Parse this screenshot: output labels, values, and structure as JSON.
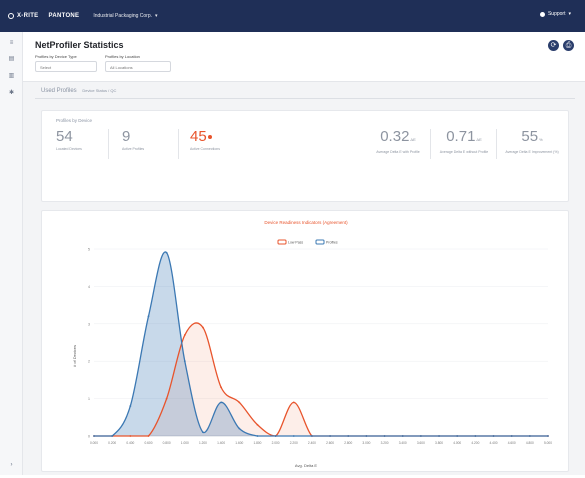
{
  "topbar": {
    "brand": "X-RITE",
    "brand_sub": "PANTONE",
    "workspace": "Industrial Packaging Corp.",
    "user": "Support"
  },
  "header": {
    "title": "NetProfiler Statistics",
    "filter1_label": "Profiles by Device Type",
    "filter1_value": "Select",
    "filter2_label": "Profiles by Location",
    "filter2_value": "All Locations"
  },
  "breadcrumb": {
    "title": "Used Profiles",
    "subtitle": "Device Status / QC"
  },
  "stats": {
    "section_title": "Profiles by Device",
    "items": [
      {
        "value": "54",
        "unit": "",
        "label": "Located Devices"
      },
      {
        "value": "9",
        "unit": "",
        "label": "Active Profiles"
      },
      {
        "value": "45",
        "unit": "",
        "label": "Active Connections"
      },
      {
        "value": "0.32",
        "unit": "ΔE",
        "label": "Average Delta E with Profile"
      },
      {
        "value": "0.71",
        "unit": "ΔE",
        "label": "Average Delta E without Profile"
      },
      {
        "value": "55",
        "unit": "%",
        "label": "Average Delta E Improvement (%)"
      }
    ]
  },
  "chart_data": {
    "type": "area",
    "title": "Device Readiness Indicators (Agreement)",
    "xlabel": "Avg. Delta E",
    "ylabel": "# of Devices",
    "ylim": [
      0,
      5
    ],
    "yticks": [
      0,
      1,
      2,
      3,
      4,
      5
    ],
    "xticks": [
      "0.000",
      "0.200",
      "0.400",
      "0.600",
      "0.800",
      "1.000",
      "1.200",
      "1.400",
      "1.600",
      "1.800",
      "2.000",
      "2.200",
      "2.400",
      "2.600",
      "2.800",
      "3.000",
      "3.200",
      "3.400",
      "3.600",
      "3.800",
      "4.000",
      "4.200",
      "4.400",
      "4.600",
      "4.800",
      "5.000"
    ],
    "legend": "top-center",
    "series": [
      {
        "name": "Low Pass",
        "color": "#e8542c",
        "values": [
          0,
          0,
          0,
          0,
          1.0,
          2.7,
          2.9,
          1.3,
          0.9,
          0.3,
          0,
          0.9,
          0,
          0,
          0,
          0,
          0,
          0,
          0,
          0,
          0,
          0,
          0,
          0,
          0,
          0
        ]
      },
      {
        "name": "Profiles",
        "color": "#3b78b3",
        "values": [
          0,
          0,
          0.8,
          3.2,
          4.9,
          2.0,
          0.1,
          0.9,
          0.2,
          0,
          0,
          0,
          0,
          0,
          0,
          0,
          0,
          0,
          0,
          0,
          0,
          0,
          0,
          0,
          0,
          0
        ]
      }
    ]
  }
}
